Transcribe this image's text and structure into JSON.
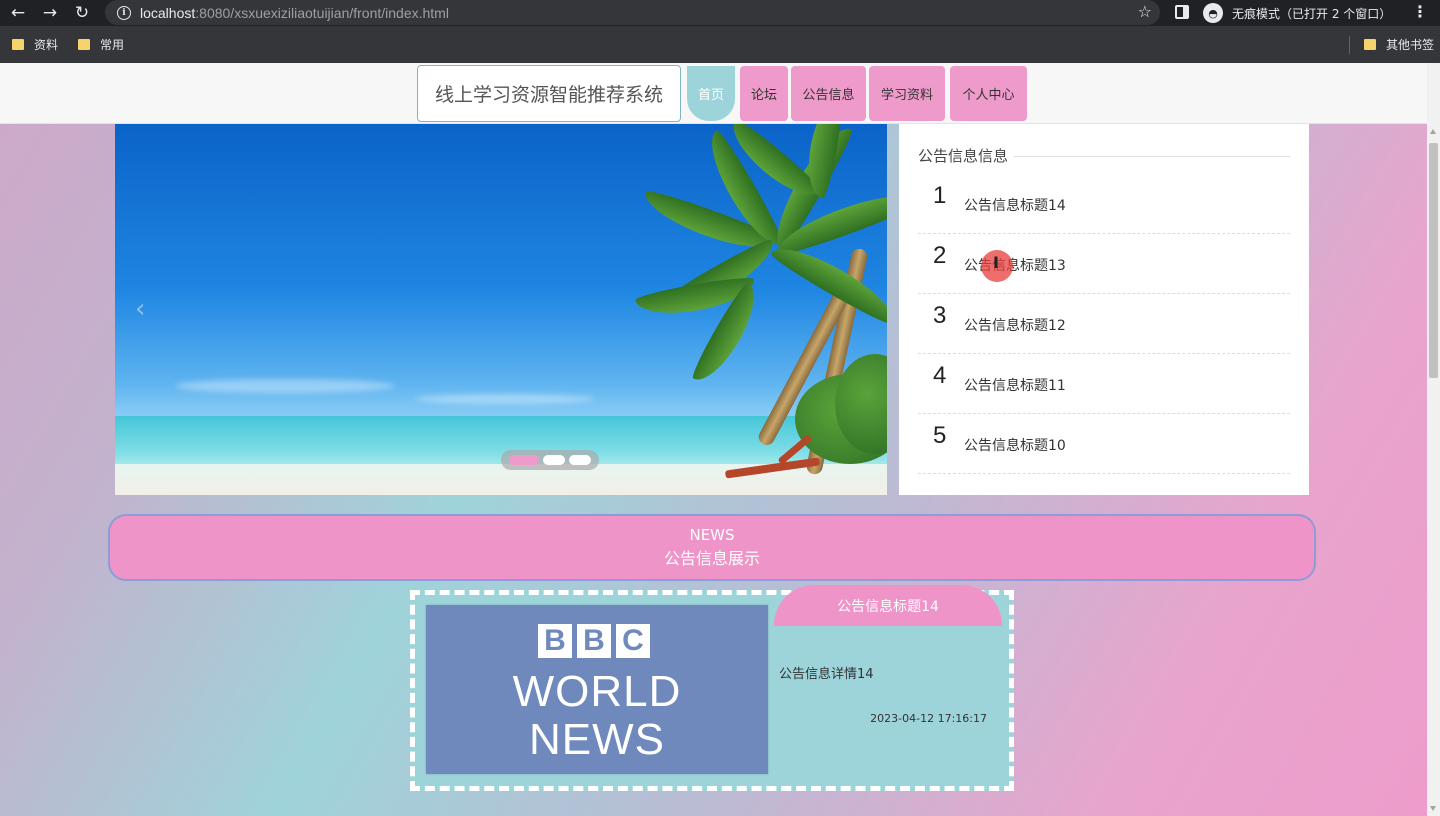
{
  "browser": {
    "url_host": "localhost",
    "url_rest": ":8080/xsxuexiziliaotuijian/front/index.html",
    "incognito_label": "无痕模式（已打开 2 个窗口）",
    "bookmarks": [
      "资料",
      "常用"
    ],
    "other_bookmarks": "其他书签"
  },
  "header": {
    "site_title": "线上学习资源智能推荐系统",
    "nav": [
      {
        "label": "首页",
        "active": true
      },
      {
        "label": "论坛",
        "active": false
      },
      {
        "label": "公告信息",
        "active": false
      },
      {
        "label": "学习资料",
        "active": false
      },
      {
        "label": "个人中心",
        "active": false
      }
    ]
  },
  "carousel": {
    "prev_arrow": "‹",
    "slide_count": 3,
    "active_slide": 1
  },
  "news_panel": {
    "heading": "公告信息信息",
    "items": [
      {
        "num": "1",
        "title": "公告信息标题14"
      },
      {
        "num": "2",
        "title": "公告信息标题13"
      },
      {
        "num": "3",
        "title": "公告信息标题12"
      },
      {
        "num": "4",
        "title": "公告信息标题11"
      },
      {
        "num": "5",
        "title": "公告信息标题10"
      }
    ]
  },
  "section_banner": {
    "en": "NEWS",
    "cn": "公告信息展示"
  },
  "news_card": {
    "image_logo": [
      "B",
      "B",
      "C"
    ],
    "image_line1": "WORLD",
    "image_line2": "NEWS",
    "title": "公告信息标题14",
    "desc": "公告信息详情14",
    "time": "2023-04-12 17:16:17"
  },
  "colors": {
    "pink": "#ee94c8",
    "teal": "#9dd4da",
    "bbc_blue": "#6f89bd"
  }
}
